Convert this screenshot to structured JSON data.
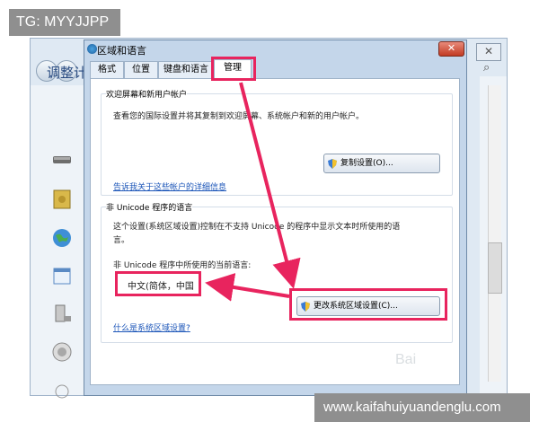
{
  "watermark_top": "TG: MYYJJPP",
  "watermark_bottom": "www.kaifahuiyuandenglu.com",
  "watermark_baidu": "Bai",
  "background_window": {
    "heading": "调整计",
    "close_glyph": "✕",
    "search_glyph": "⌕"
  },
  "dialog": {
    "title": "区域和语言",
    "close_glyph": "✕",
    "tabs": [
      "格式",
      "位置",
      "键盘和语言",
      "管理"
    ],
    "welcome_group": {
      "label": "欢迎屏幕和新用户帐户",
      "description": "查看您的国际设置并将其复制到欢迎屏幕、系统帐户和新的用户帐户。",
      "copy_button": "复制设置(O)...",
      "link": "告诉我关于这些帐户的详细信息"
    },
    "unicode_group": {
      "label": "非 Unicode 程序的语言",
      "description_line1": "这个设置(系统区域设置)控制在不支持 Unicode 的程序中显示文本时所使用的语",
      "description_line2": "言。",
      "current_label": "非 Unicode 程序中所使用的当前语言:",
      "current_value": "中文(简体，中国",
      "change_button": "更改系统区域设置(C)...",
      "link": "什么是系统区域设置?"
    }
  },
  "colors": {
    "highlight": "#e8245e",
    "link": "#1b55b8"
  }
}
